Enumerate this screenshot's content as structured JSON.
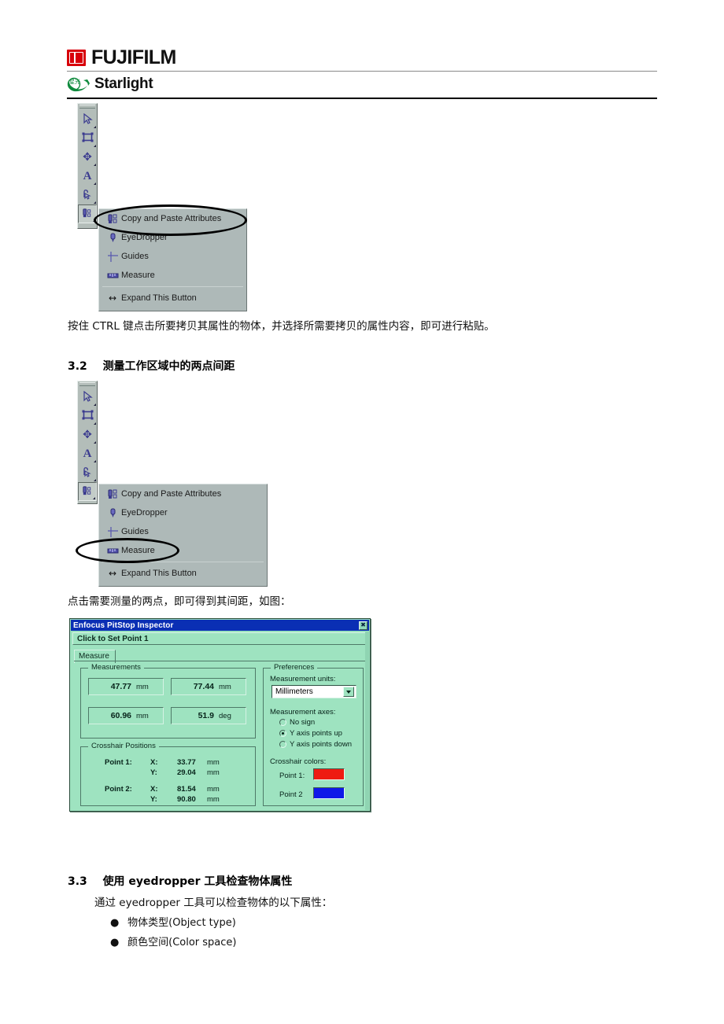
{
  "header": {
    "brand": "FUJIFILM",
    "product": "Starlight",
    "brand_mark_color": "#d8000a",
    "product_mark_color": "#0f8a3d",
    "product_mark_cjk": "星光"
  },
  "figure1": {
    "name": "pitstop-toolbar-flyout-copy-paste",
    "toolbar_tools": [
      {
        "name": "select-tool",
        "glyph": "➤"
      },
      {
        "name": "object-select-tool",
        "glyph": "▭"
      },
      {
        "name": "move-tool",
        "glyph": "✥"
      },
      {
        "name": "text-tool",
        "glyph": "A"
      },
      {
        "name": "edit-path-tool",
        "glyph": "⤳"
      },
      {
        "name": "copy-paste-attributes-tool",
        "glyph": "⬆"
      }
    ],
    "menu_items": [
      {
        "label": "Copy and Paste Attributes",
        "icon": "copy-paste-attributes-icon"
      },
      {
        "label": "EyeDropper",
        "icon": "eyedropper-icon"
      },
      {
        "label": "Guides",
        "icon": "guides-crosshair-icon"
      },
      {
        "label": "Measure",
        "icon": "measure-ruler-icon"
      }
    ],
    "expand_label": "Expand This Button",
    "expand_icon": "↔",
    "highlighted_item": "Copy and Paste Attributes"
  },
  "para1": "按住 CTRL 键点击所要拷贝其属性的物体，并选择所需要拷贝的属性内容，即可进行粘贴。",
  "section32": {
    "number": "3.2",
    "title": "测量工作区域中的两点间距"
  },
  "figure2": {
    "name": "pitstop-toolbar-flyout-measure",
    "menu_items": [
      {
        "label": "Copy and Paste Attributes",
        "icon": "copy-paste-attributes-icon"
      },
      {
        "label": "EyeDropper",
        "icon": "eyedropper-icon"
      },
      {
        "label": "Guides",
        "icon": "guides-crosshair-icon"
      },
      {
        "label": "Measure",
        "icon": "measure-ruler-icon"
      }
    ],
    "expand_label": "Expand This Button",
    "expand_icon": "↔",
    "highlighted_item": "Measure"
  },
  "para2": "点击需要测量的两点，即可得到其间距，如图：",
  "dialog": {
    "title": "Enfocus PitStop Inspector",
    "close_glyph": "✖",
    "titlebar_color": "#0a2fb4",
    "background_color": "#9ee3c0",
    "status": "Click to Set Point 1",
    "tab": "Measure",
    "measurements": {
      "legend": "Measurements",
      "fields": [
        {
          "name": "delta-x-field",
          "value": "47.77",
          "unit": "mm"
        },
        {
          "name": "delta-y-field",
          "value": "77.44",
          "unit": "mm"
        },
        {
          "name": "distance-field",
          "value": "60.96",
          "unit": "mm"
        },
        {
          "name": "angle-field",
          "value": "51.9",
          "unit": "deg"
        }
      ]
    },
    "crosshair": {
      "legend": "Crosshair Positions",
      "rows": [
        {
          "point": "Point 1:",
          "x_label": "X:",
          "x_value": "33.77",
          "x_unit": "mm",
          "y_label": "Y:",
          "y_value": "29.04",
          "y_unit": "mm"
        },
        {
          "point": "Point 2:",
          "x_label": "X:",
          "x_value": "81.54",
          "x_unit": "mm",
          "y_label": "Y:",
          "y_value": "90.80",
          "y_unit": "mm"
        }
      ]
    },
    "preferences": {
      "legend": "Preferences",
      "units_label": "Measurement units:",
      "units_value": "Millimeters",
      "units_options": [
        "Millimeters"
      ],
      "axes_label": "Measurement axes:",
      "axes_options": [
        {
          "label": "No sign",
          "selected": false
        },
        {
          "label": "Y axis points up",
          "selected": true
        },
        {
          "label": "Y axis points down",
          "selected": false
        }
      ],
      "colors_label": "Crosshair colors:",
      "color_rows": [
        {
          "label": "Point 1:",
          "color": "#ee1b12"
        },
        {
          "label": "Point 2",
          "color": "#0f19e8"
        }
      ]
    }
  },
  "section33": {
    "number": "3.3",
    "title": "使用 eyedropper 工具检查物体属性",
    "intro": "通过 eyedropper 工具可以检查物体的以下属性：",
    "bullets": [
      "物体类型(Object type)",
      "颜色空间(Color space)"
    ],
    "bullet_glyph": "●"
  }
}
